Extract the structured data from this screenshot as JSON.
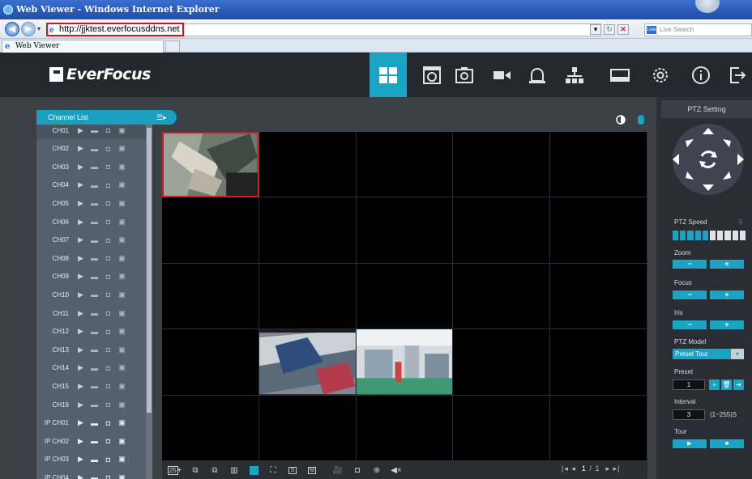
{
  "browser": {
    "title": "Web Viewer - Windows Internet Explorer",
    "address": "http://jjktest.everfocusddns.net",
    "search_placeholder": "Live Search",
    "search_logo": "Live",
    "tab_label": "Web Viewer",
    "back_icon": "back-arrow-icon",
    "forward_icon": "forward-arrow-icon"
  },
  "app": {
    "brand": "EverFocus",
    "nav": [
      {
        "name": "live-view",
        "icon": "grid-icon",
        "active": true
      },
      {
        "name": "playback",
        "icon": "playback-icon"
      },
      {
        "name": "snapshot",
        "icon": "snapshot-icon"
      },
      {
        "name": "record",
        "icon": "camera-icon"
      },
      {
        "name": "alarm",
        "icon": "bell-icon"
      },
      {
        "name": "network",
        "icon": "network-icon"
      },
      {
        "name": "storage",
        "icon": "hdd-icon"
      },
      {
        "name": "settings",
        "icon": "gear-icon"
      },
      {
        "name": "info",
        "icon": "info-icon"
      },
      {
        "name": "logout",
        "icon": "logout-icon"
      }
    ]
  },
  "channel_list": {
    "title": "Channel List",
    "channels": [
      "CH01",
      "CH02",
      "CH03",
      "CH04",
      "CH05",
      "CH06",
      "CH07",
      "CH08",
      "CH09",
      "CH10",
      "CH11",
      "CH12",
      "CH13",
      "CH14",
      "CH15",
      "CH16",
      "IP CH01",
      "IP CH02",
      "IP CH03",
      "IP CH04"
    ]
  },
  "video_toolbar": {
    "layout_value": "25",
    "page_current": "1",
    "page_sep": "/",
    "page_total": "1"
  },
  "ptz": {
    "title": "PTZ Setting",
    "speed_label": "PTZ Speed",
    "speed_value": "5",
    "speed_level": 5,
    "speed_max": 10,
    "zoom_label": "Zoom",
    "focus_label": "Focus",
    "iris_label": "Iris",
    "minus": "−",
    "plus": "+",
    "model_label": "PTZ Model",
    "model_value": "Preset Tour",
    "preset_label": "Preset",
    "preset_value": "1",
    "interval_label": "Interval",
    "interval_value": "3",
    "interval_range": "(1~255)S",
    "tour_label": "Tour",
    "tour_play": "▶",
    "tour_stop": "■"
  },
  "colors": {
    "accent": "#1aa3c3",
    "selected_border": "#d01c24"
  }
}
